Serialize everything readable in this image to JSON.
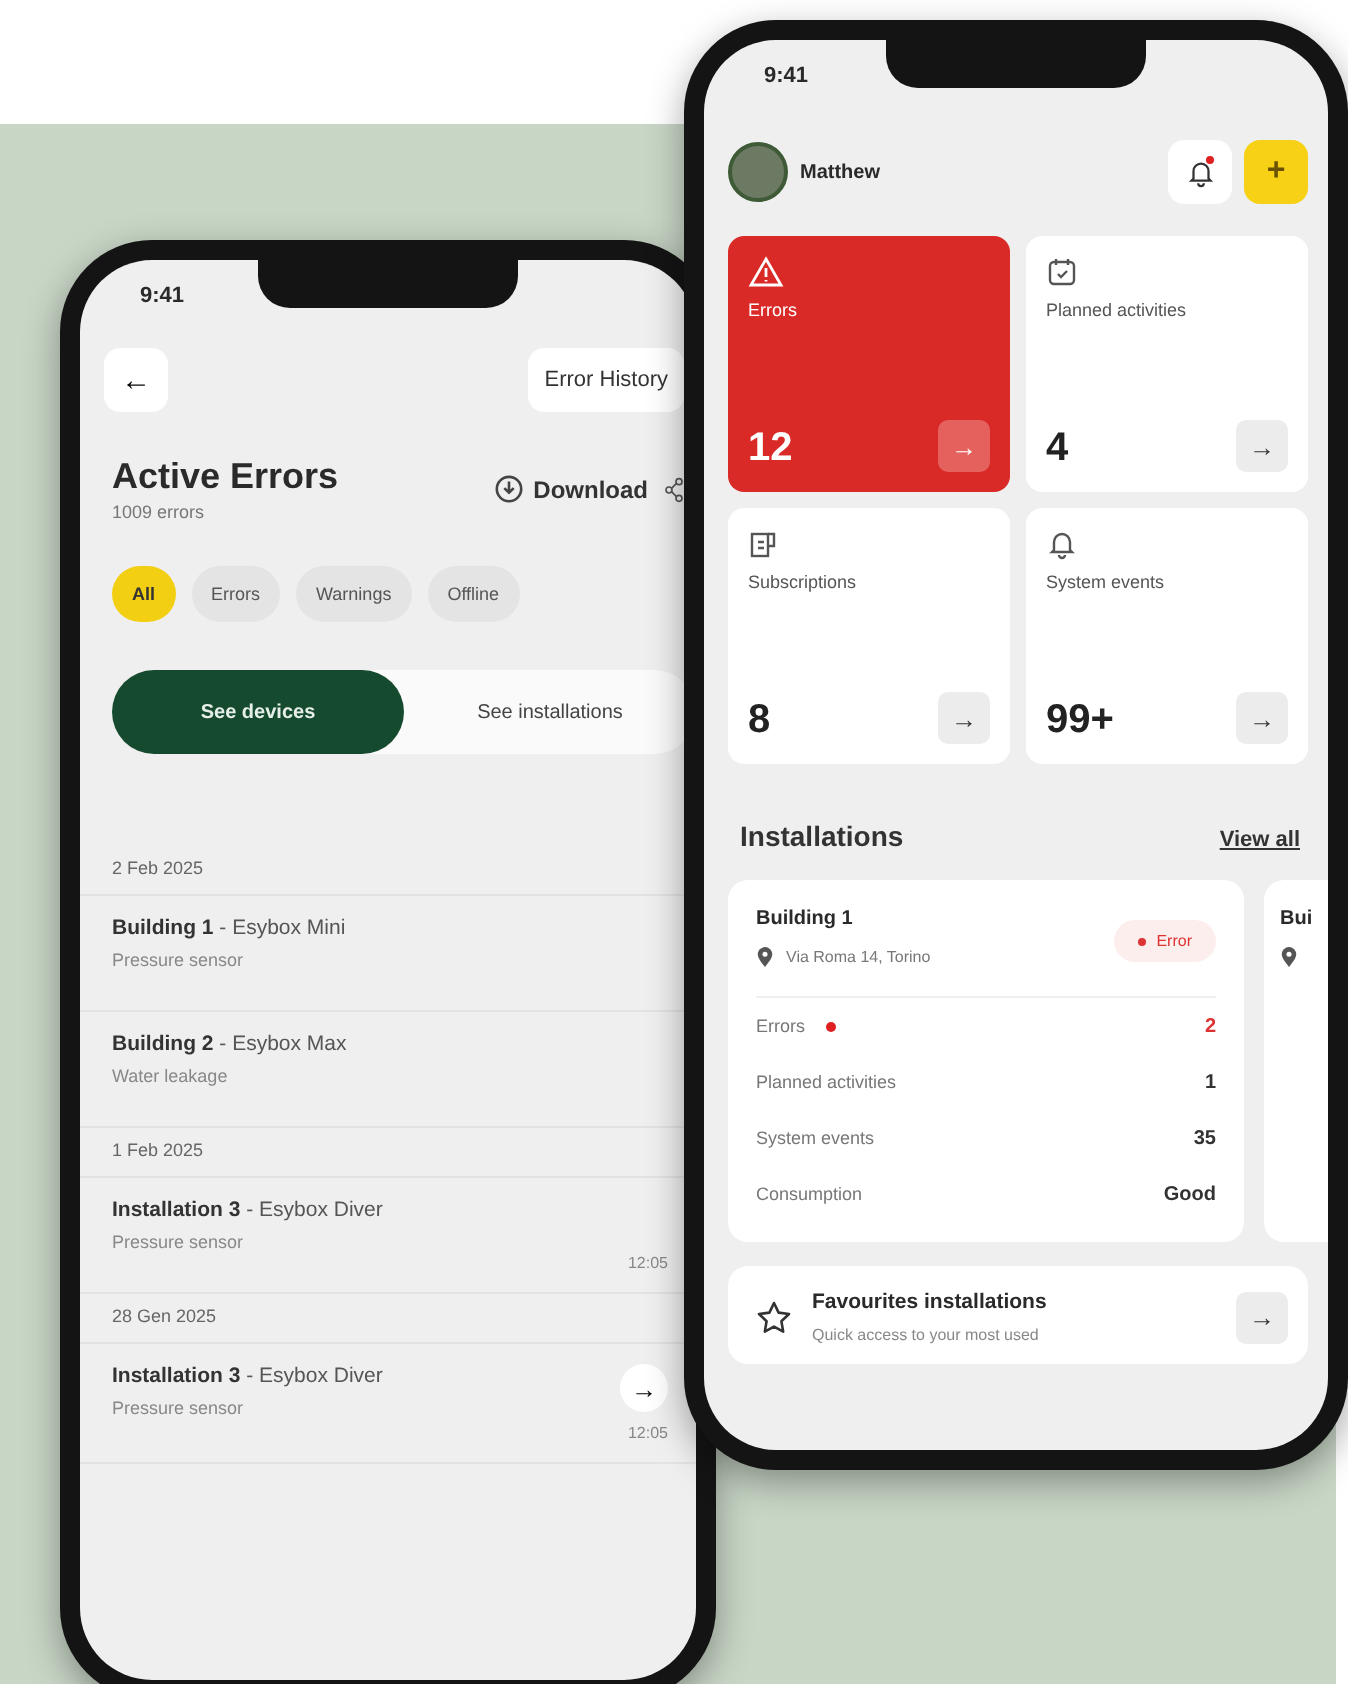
{
  "left_phone": {
    "status_time": "9:41",
    "back_label": "←",
    "history_button": "Error History",
    "title": "Active Errors",
    "subtitle": "1009 errors",
    "download_label": "Download",
    "filters": [
      {
        "label": "All",
        "selected": true
      },
      {
        "label": "Errors",
        "selected": false
      },
      {
        "label": "Warnings",
        "selected": false
      },
      {
        "label": "Offline",
        "selected": false
      }
    ],
    "segments": [
      {
        "label": "See devices",
        "selected": true
      },
      {
        "label": "See installations",
        "selected": false
      }
    ],
    "list": [
      {
        "kind": "date",
        "text": "2 Feb 2025"
      },
      {
        "kind": "row",
        "title": "**Building 1** - Esybox Mini",
        "issue": "Pressure sensor"
      },
      {
        "kind": "row",
        "title": "**Building 2** - Esybox Max",
        "issue": "Water leakage"
      },
      {
        "kind": "date",
        "text": "1 Feb 2025"
      },
      {
        "kind": "row",
        "title": "**Installation 3** - Esybox Diver",
        "issue": "Pressure sensor",
        "time": "12:05"
      },
      {
        "kind": "date",
        "text": "28 Gen 2025"
      },
      {
        "kind": "row",
        "title": "**Installation 3** - Esybox Diver",
        "issue": "Pressure sensor",
        "time": "12:05",
        "arrow": "→"
      }
    ]
  },
  "right_phone": {
    "status_time": "9:41",
    "user_name": "Matthew",
    "notification_unread": true,
    "add_label": "+",
    "tiles": [
      {
        "kind": "alert",
        "label": "Errors",
        "count": "12",
        "arrow": "→"
      },
      {
        "kind": "normal",
        "label": "Planned activities",
        "count": "4",
        "arrow": "→"
      },
      {
        "kind": "normal",
        "label": "Subscriptions",
        "count": "8",
        "arrow": "→"
      },
      {
        "kind": "normal",
        "label": "System events",
        "count": "99+",
        "arrow": "→"
      }
    ],
    "installations_title": "Installations",
    "view_all": "View all",
    "installation_card": {
      "name": "Building 1",
      "address": "Via Roma 14, Torino",
      "status": "Error",
      "stats": [
        {
          "kind": "error",
          "label": "Errors",
          "value": "2"
        },
        {
          "kind": "normal",
          "label": "Planned activities",
          "value": "1"
        },
        {
          "kind": "normal",
          "label": "System events",
          "value": "35"
        },
        {
          "kind": "normal",
          "label": "Consumption",
          "value": "Good"
        }
      ]
    },
    "next_card_name": "Bui",
    "favourites": {
      "title": "Favourites installations",
      "subtitle": "Quick access to your most used",
      "arrow": "→"
    }
  }
}
